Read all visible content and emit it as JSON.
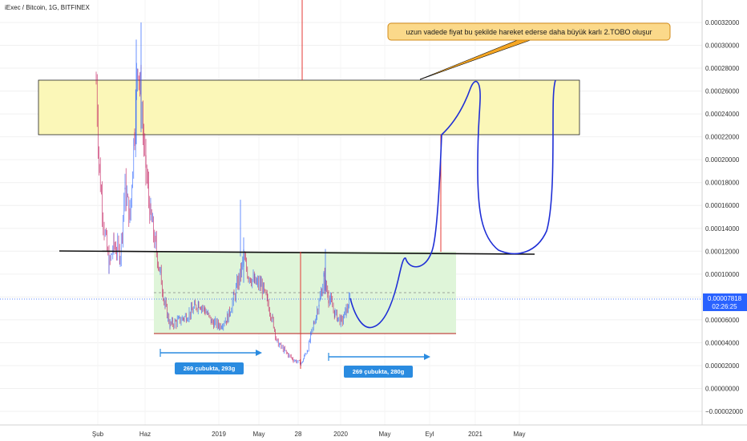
{
  "chart_data": {
    "type": "candlestick",
    "title": "iExec / Bitcoin, 1G, BITFINEX",
    "x_ticks": [
      "Şub",
      "Haz",
      "2019",
      "May",
      "28",
      "2020",
      "May",
      "Eyl",
      "2021",
      "May"
    ],
    "y_ticks": [
      "0.00032000",
      "0.00030000",
      "0.00028000",
      "0.00026000",
      "0.00024000",
      "0.00022000",
      "0.00020000",
      "0.00018000",
      "0.00016000",
      "0.00014000",
      "0.00012000",
      "0.00010000",
      "0.00008000",
      "0.00006000",
      "0.00004000",
      "0.00002000",
      "0.00000000",
      "−0.00002000"
    ],
    "ylim": [
      -2.5e-05,
      0.000345
    ],
    "y_tick_values": [
      0.00032,
      0.0003,
      0.00028,
      0.00026,
      0.00024,
      0.00022,
      0.0002,
      0.00018,
      0.00016,
      0.00014,
      0.00012,
      0.0001,
      8e-05,
      6e-05,
      4e-05,
      2e-05,
      0,
      -2e-05
    ],
    "last_price": "0.00007818",
    "countdown": "02:26:25",
    "annotation": "uzun vadede fiyat bu şekilde hareket ederse daha büyük karlı 2.TOBO oluşur",
    "measure_1": "269 çubukta, 293g",
    "measure_2": "269 çubukta, 280g",
    "zones": [
      {
        "kind": "resistance",
        "from": 0.00022,
        "to": 0.000268
      },
      {
        "kind": "range",
        "from": 4.9e-05,
        "to": 0.00012
      }
    ],
    "neckline": 0.00012,
    "colors": {
      "up": "#2962ff",
      "down": "#c2185b",
      "projection": "#1f2fd6",
      "vertical": "#e53935",
      "neckline": "#111111",
      "price_line": "#2962ff"
    }
  }
}
